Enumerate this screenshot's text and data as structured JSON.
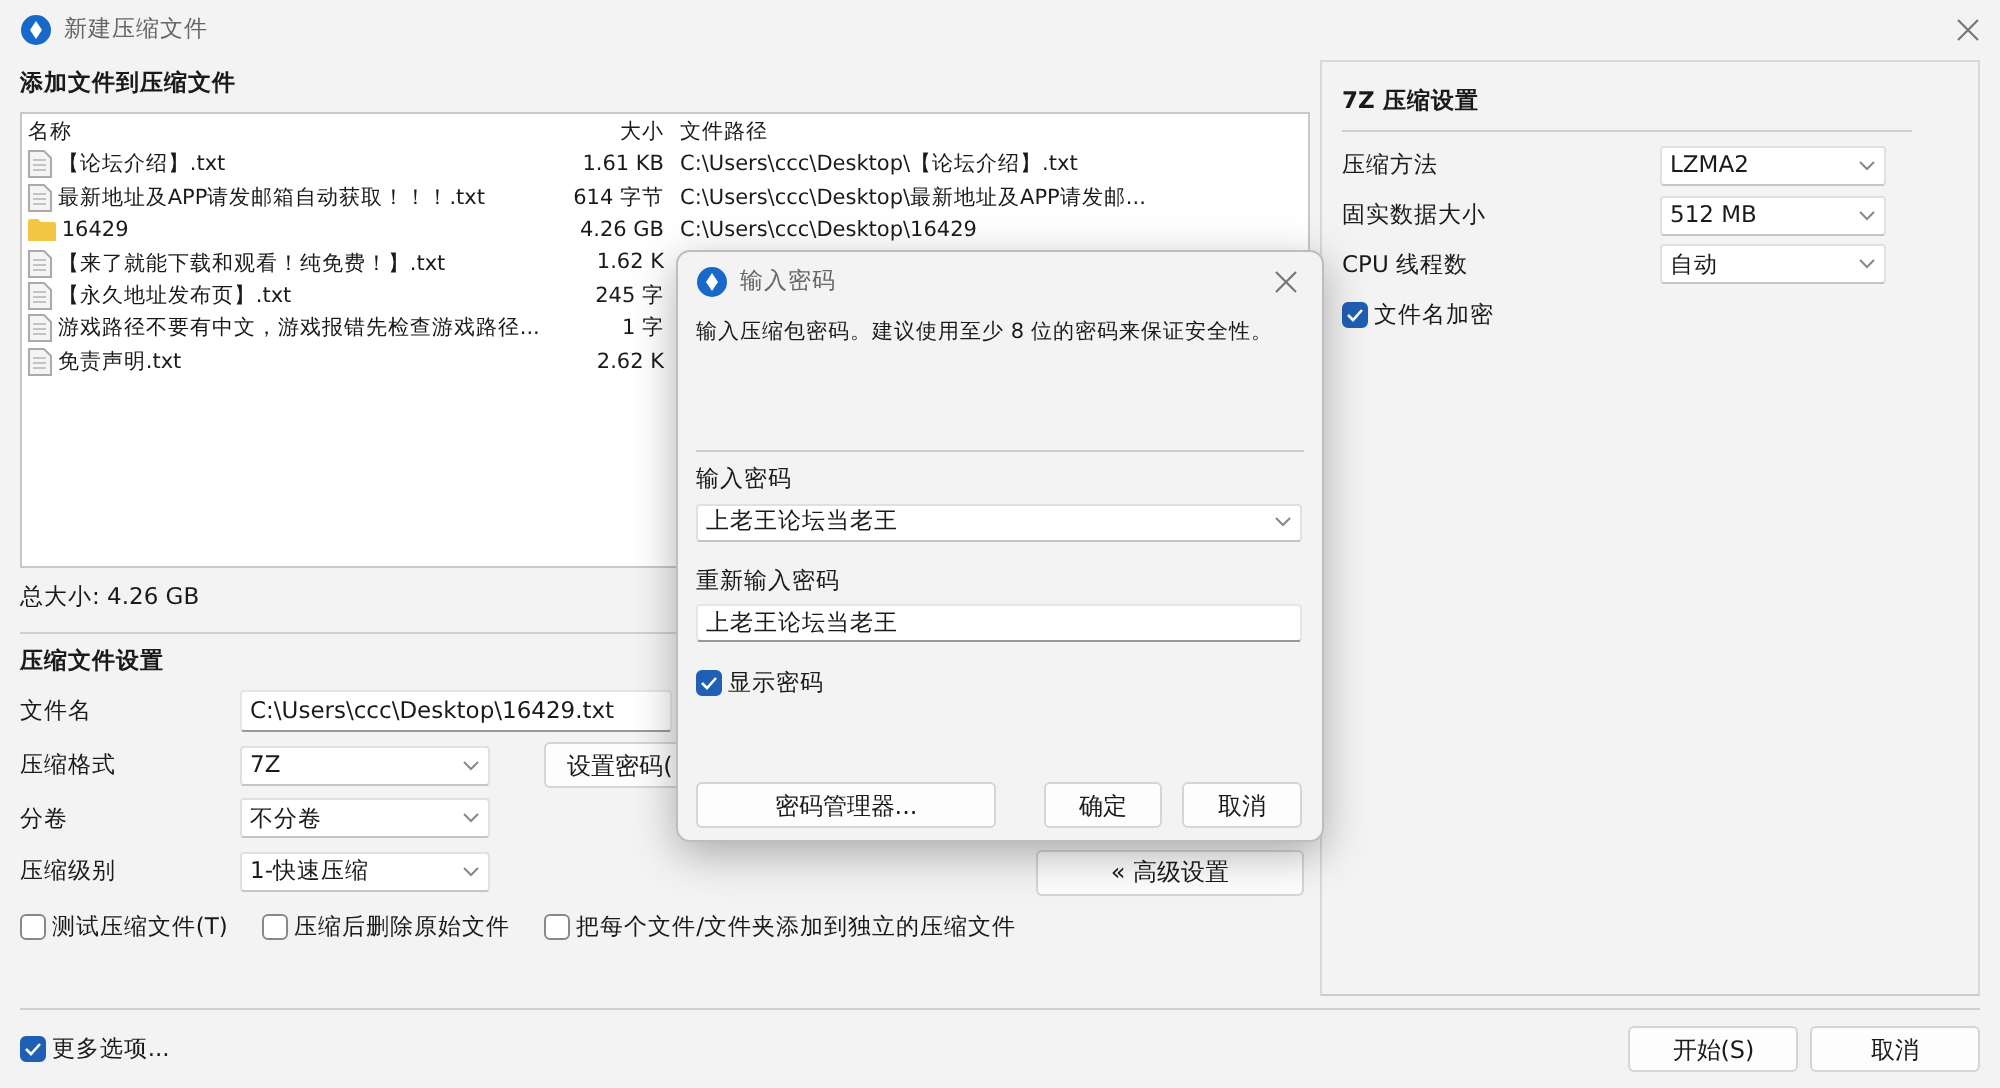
{
  "window": {
    "title": "新建压缩文件"
  },
  "files": {
    "heading": "添加文件到压缩文件",
    "columns": [
      "名称",
      "大小",
      "文件路径"
    ],
    "rows": [
      {
        "kind": "file",
        "name": "【论坛介绍】.txt",
        "size": "1.61 KB",
        "path": "C:\\Users\\ccc\\Desktop\\【论坛介绍】.txt"
      },
      {
        "kind": "file",
        "name": "最新地址及APP请发邮箱自动获取！！！.txt",
        "size": "614 字节",
        "path": "C:\\Users\\ccc\\Desktop\\最新地址及APP请发邮..."
      },
      {
        "kind": "folder",
        "name": "16429",
        "size": "4.26 GB",
        "path": "C:\\Users\\ccc\\Desktop\\16429"
      },
      {
        "kind": "file",
        "name": "【来了就能下载和观看！纯免费！】.txt",
        "size": "1.62 K"
      },
      {
        "kind": "file",
        "name": "【永久地址发布页】.txt",
        "size": "245 字"
      },
      {
        "kind": "file",
        "name": "游戏路径不要有中文，游戏报错先检查游戏路径...",
        "size": "1 字"
      },
      {
        "kind": "file",
        "name": "免责声明.txt",
        "size": "2.62 K"
      }
    ]
  },
  "total": "总大小: 4.26 GB",
  "settings": {
    "heading": "压缩文件设置",
    "filename_label": "文件名",
    "filename": "C:\\Users\\ccc\\Desktop\\16429.txt",
    "rows": [
      {
        "label": "压缩格式",
        "value": "7Z"
      },
      {
        "label": "分卷",
        "value": "不分卷"
      },
      {
        "label": "压缩级别",
        "value": "1-快速压缩"
      }
    ],
    "password_button": "设置密码(",
    "advanced_button": "« 高级设置",
    "options": [
      {
        "label": "测试压缩文件(T)",
        "checked": false
      },
      {
        "label": "压缩后删除原始文件",
        "checked": false
      },
      {
        "label": "把每个文件/文件夹添加到独立的压缩文件",
        "checked": false
      }
    ]
  },
  "more_options": {
    "label": "更多选项...",
    "checked": true
  },
  "advanced": {
    "heading": "7Z 压缩设置",
    "rows": [
      {
        "label": "压缩方法",
        "value": "LZMA2"
      },
      {
        "label": "固实数据大小",
        "value": "512 MB"
      },
      {
        "label": "CPU 线程数",
        "value": "自动"
      }
    ],
    "encrypt_names": {
      "label": "文件名加密",
      "checked": true
    }
  },
  "buttons": [
    "开始(S)",
    "取消"
  ],
  "dialog": {
    "title": "输入密码",
    "message": "输入压缩包密码。建议使用至少 8 位的密码来保证安全性。",
    "password_label": "输入密码",
    "password": "上老王论坛当老王",
    "confirm_label": "重新输入密码",
    "confirm": "上老王论坛当老王",
    "show_password": {
      "label": "显示密码",
      "checked": true
    },
    "buttons": [
      "密码管理器...",
      "确定",
      "取消"
    ]
  }
}
